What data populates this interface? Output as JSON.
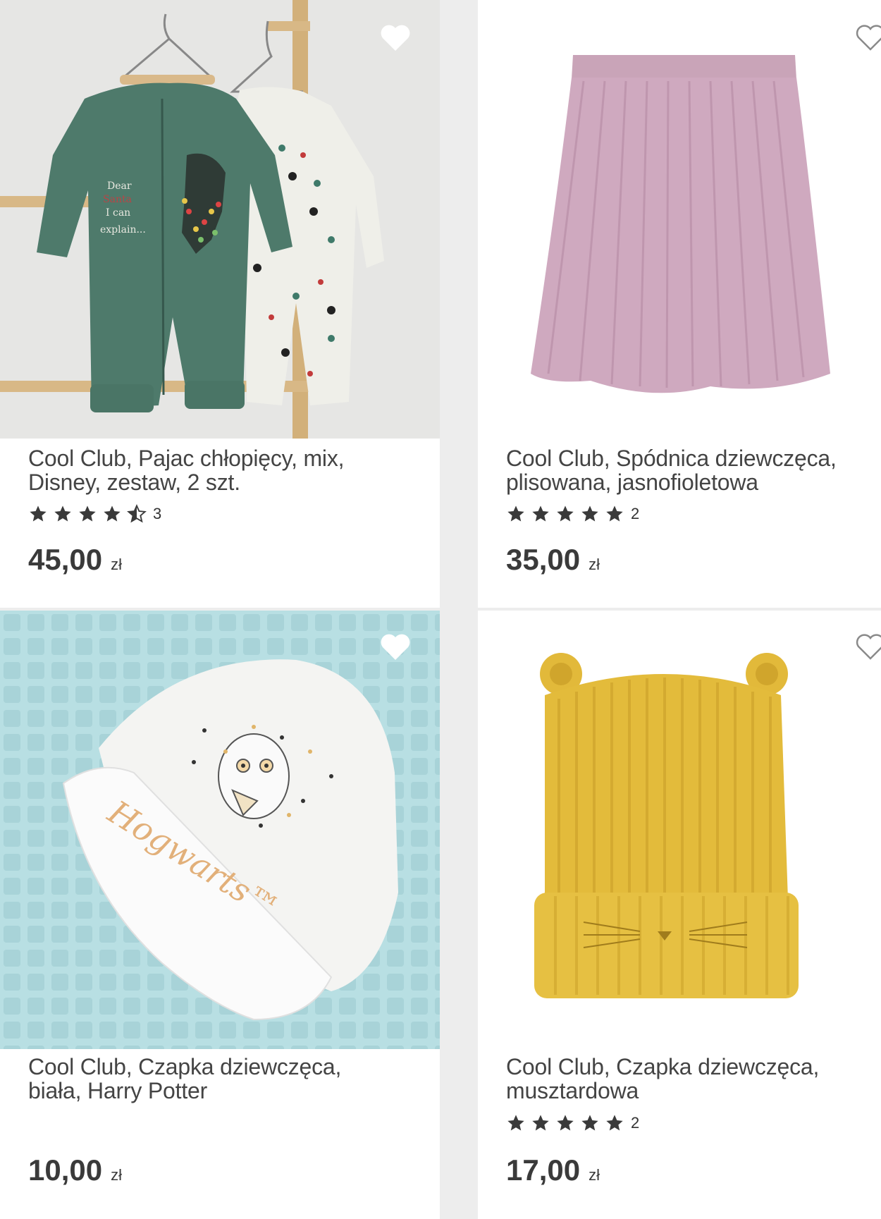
{
  "products": [
    {
      "name_line1": "Cool Club, Pajac chłopięcy, mix,",
      "name_line2": "Disney, zestaw, 2 szt.",
      "rating": 4.5,
      "rating_count": "3",
      "price": "45,00",
      "currency": "zł",
      "favorite_icon": "heart-icon",
      "image": "green-romper-set-photo"
    },
    {
      "name_line1": "Cool Club, Spódnica dziewczęca,",
      "name_line2": "plisowana, jasnofioletowa",
      "rating": 5,
      "rating_count": "2",
      "price": "35,00",
      "currency": "zł",
      "favorite_icon": "heart-icon",
      "image": "pink-pleated-skirt-photo"
    },
    {
      "name_line1": "Cool Club, Czapka dziewczęca,",
      "name_line2": "biała, Harry Potter",
      "price": "10,00",
      "currency": "zł",
      "favorite_icon": "heart-icon",
      "image": "white-hogwarts-hat-photo",
      "hat_print": "Hogwarts™"
    },
    {
      "name_line1": "Cool Club, Czapka dziewczęca,",
      "name_line2": "musztardowa",
      "rating": 5,
      "rating_count": "2",
      "price": "17,00",
      "currency": "zł",
      "favorite_icon": "heart-icon",
      "image": "mustard-cat-beanie-photo"
    }
  ],
  "colors": {
    "background": "#ededed",
    "card": "#ffffff",
    "text": "#3d3d3d",
    "star": "#3a3a3a"
  }
}
